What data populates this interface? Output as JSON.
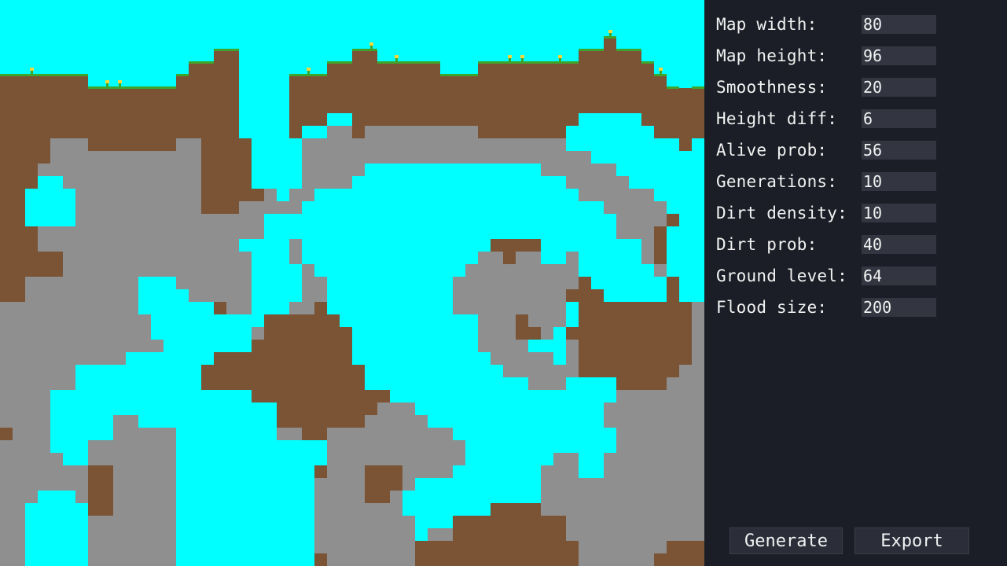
{
  "colors": {
    "water": "#00ffff",
    "dirt": "#7a5435",
    "stone": "#8f8f8f",
    "grass": "#3ea52c",
    "flower": "#f4d73c",
    "panel_bg": "#1b1e26",
    "field_bg": "#333641",
    "button_bg": "#2b2e39",
    "text": "#f2f2f2"
  },
  "settings": [
    {
      "label": "Map width:",
      "value": "80"
    },
    {
      "label": "Map height:",
      "value": "96"
    },
    {
      "label": "Smoothness:",
      "value": "20"
    },
    {
      "label": "Height diff:",
      "value": "6"
    },
    {
      "label": "Alive prob:",
      "value": "56"
    },
    {
      "label": "Generations:",
      "value": "10"
    },
    {
      "label": "Dirt density:",
      "value": "10"
    },
    {
      "label": "Dirt prob:",
      "value": "40"
    },
    {
      "label": "Ground level:",
      "value": "64"
    },
    {
      "label": "Flood size:",
      "value": "200"
    }
  ],
  "buttons": {
    "generate": "Generate",
    "export": "Export"
  }
}
